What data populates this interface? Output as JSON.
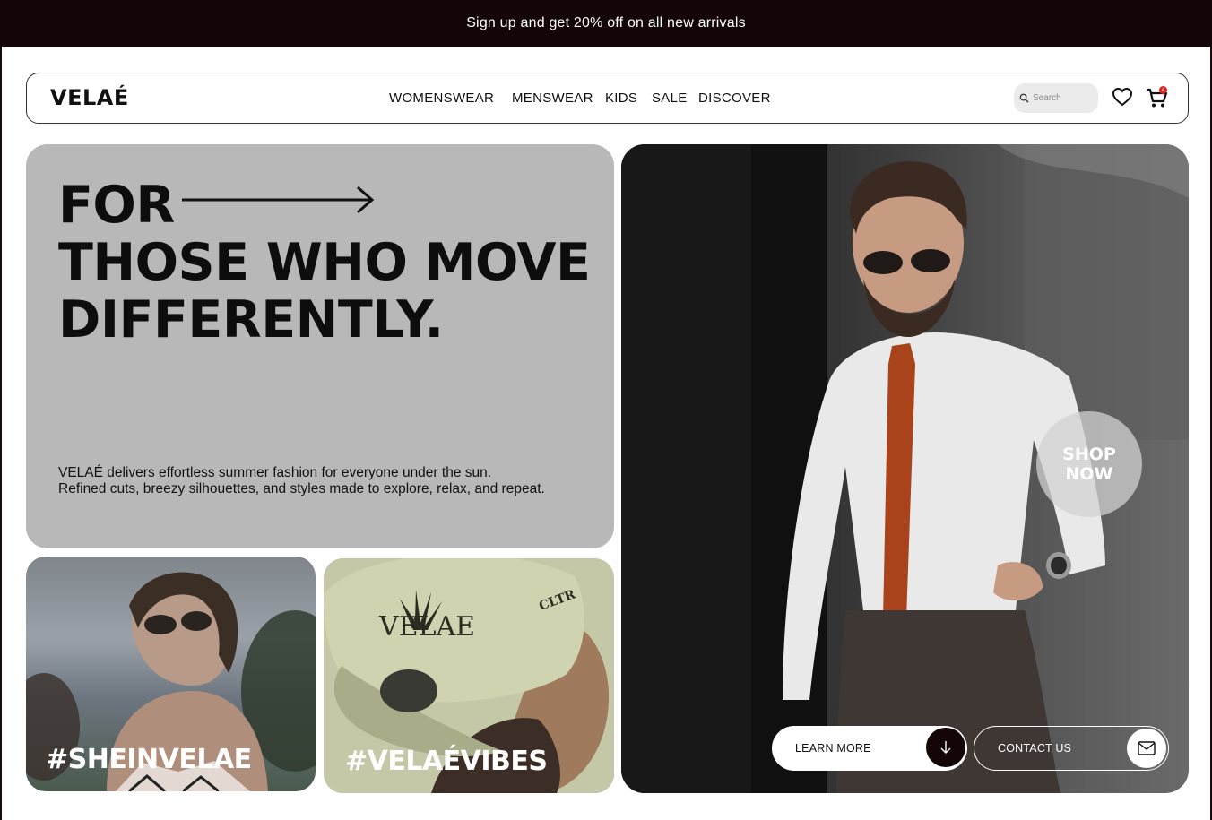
{
  "promo": {
    "text": "Sign up and get 20% off on all new arrivals"
  },
  "header": {
    "logo": "VELAÉ",
    "menu": [
      "WOMENSWEAR",
      "MENSWEAR",
      "KIDS",
      "SALE",
      "DISCOVER"
    ],
    "search_placeholder": "Search",
    "cart_count": "4",
    "icons": {
      "search": "search-icon",
      "wishlist": "heart-icon",
      "cart": "cart-icon"
    }
  },
  "hero": {
    "line1": "FOR",
    "line2": "THOSE WHO MOVE",
    "line3": "DIFFERENTLY.",
    "desc1": "VELAÉ delivers effortless summer fashion for everyone under the sun.",
    "desc2": "Refined cuts, breezy silhouettes, and styles made to explore, relax, and repeat."
  },
  "tiles": [
    {
      "tag": "#SHEINVELAE"
    },
    {
      "tag": "#VELAÉVIBES"
    }
  ],
  "feature": {
    "shop_line1": "SHOP",
    "shop_line2": "NOW",
    "learn_more": "LEARN MORE",
    "contact_us": "CONTACT US"
  },
  "colors": {
    "accent": "#140507",
    "card": "#b8b8b8"
  }
}
